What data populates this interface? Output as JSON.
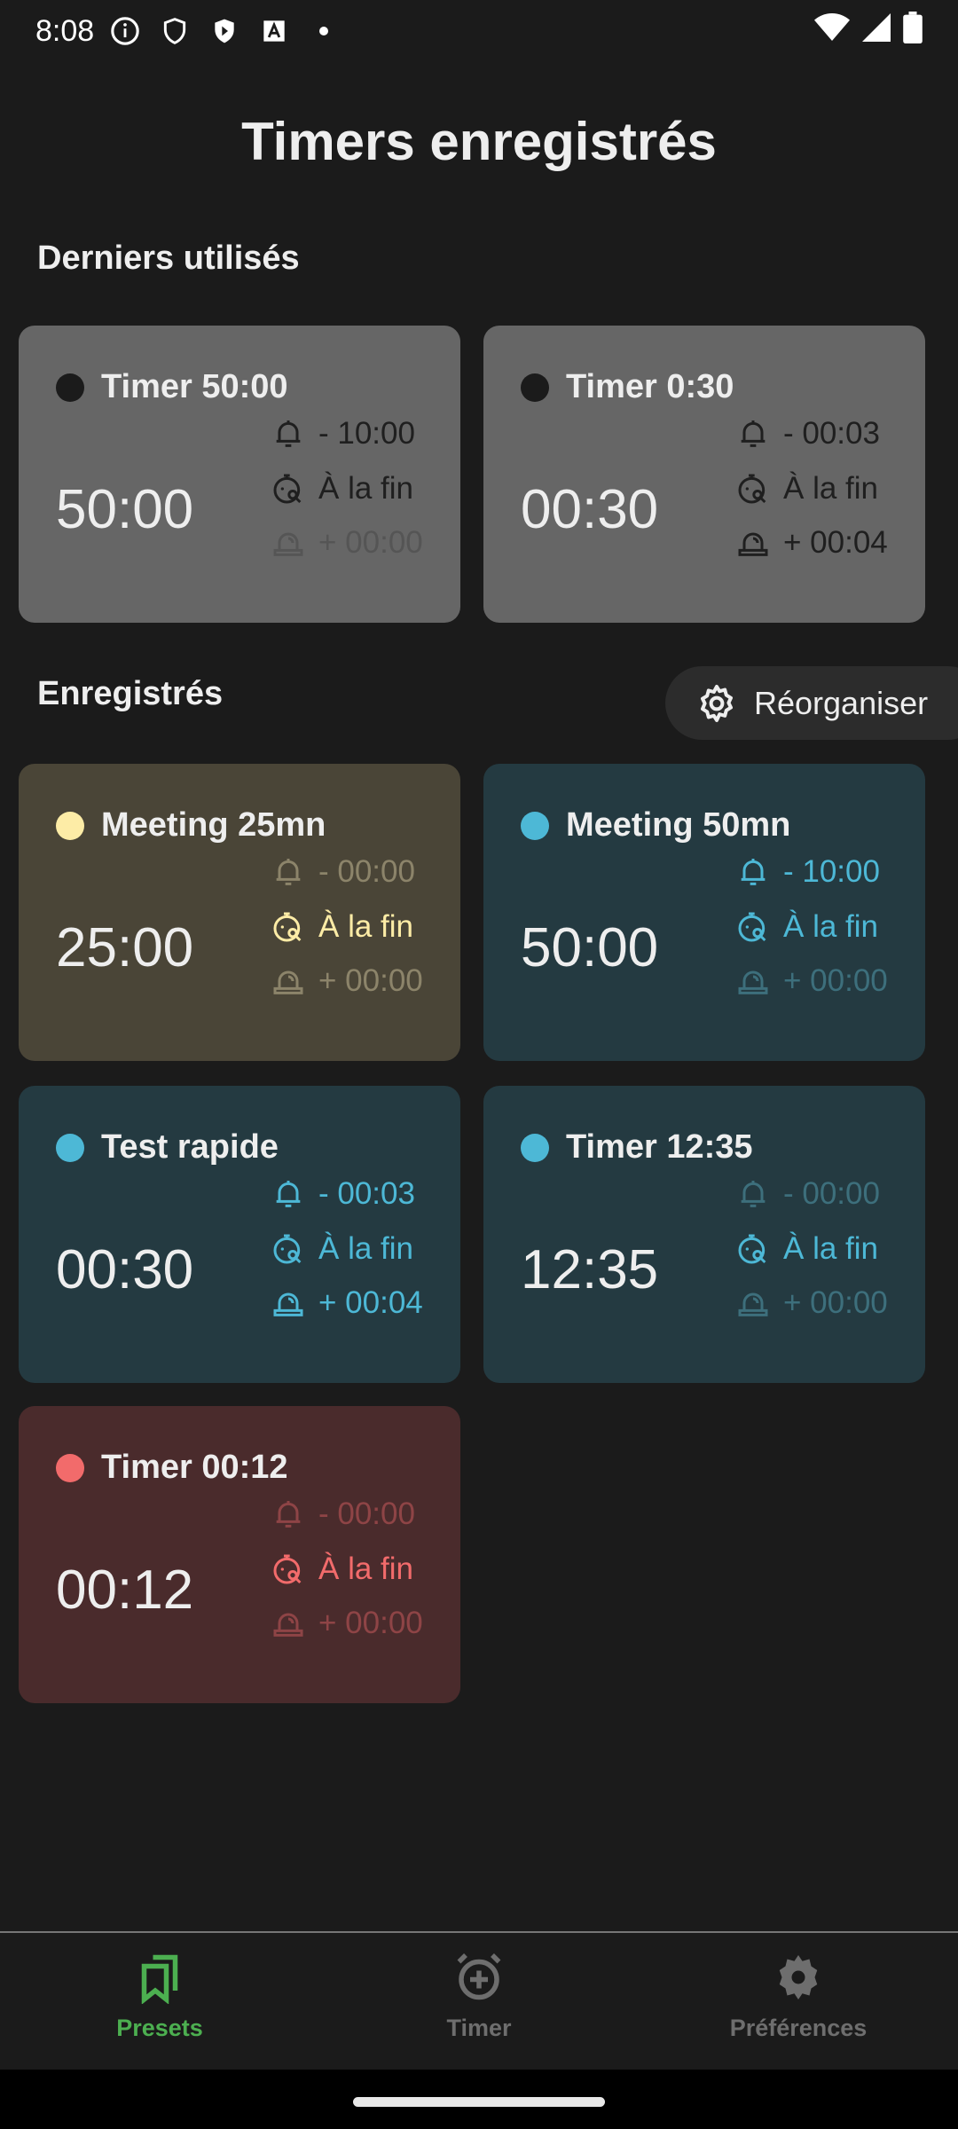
{
  "status_bar": {
    "time": "8:08"
  },
  "title": "Timers enregistrés",
  "recent_section": "Derniers utilisés",
  "saved_section": "Enregistrés",
  "reorganize_button": "Réorganiser",
  "colors": {
    "gray": "#666666",
    "yellow": "#fdeca6",
    "teal": "#4db8d6",
    "red": "#f26b6b",
    "accent_green": "#4caf50"
  },
  "recent": [
    {
      "name": "Timer 50:00",
      "duration": "50:00",
      "prealert": "- 10:00",
      "end": "À la fin",
      "overtime": "+ 00:00",
      "theme": "gray",
      "active": [
        true,
        true,
        false
      ]
    },
    {
      "name": "Timer 0:30",
      "duration": "00:30",
      "prealert": "- 00:03",
      "end": "À la fin",
      "overtime": "+ 00:04",
      "theme": "gray",
      "active": [
        true,
        true,
        true
      ]
    }
  ],
  "saved": [
    {
      "name": "Meeting 25mn",
      "duration": "25:00",
      "prealert": "- 00:00",
      "end": "À la fin",
      "overtime": "+ 00:00",
      "theme": "yellow",
      "active": [
        false,
        true,
        false
      ]
    },
    {
      "name": "Meeting 50mn",
      "duration": "50:00",
      "prealert": "- 10:00",
      "end": "À la fin",
      "overtime": "+ 00:00",
      "theme": "teal",
      "active": [
        true,
        true,
        false
      ]
    },
    {
      "name": "Test rapide",
      "duration": "00:30",
      "prealert": "- 00:03",
      "end": "À la fin",
      "overtime": "+ 00:04",
      "theme": "teal",
      "active": [
        true,
        true,
        true
      ]
    },
    {
      "name": "Timer 12:35",
      "duration": "12:35",
      "prealert": "- 00:00",
      "end": "À la fin",
      "overtime": "+ 00:00",
      "theme": "teal",
      "active": [
        false,
        true,
        false
      ]
    },
    {
      "name": "Timer 00:12",
      "duration": "00:12",
      "prealert": "- 00:00",
      "end": "À la fin",
      "overtime": "+ 00:00",
      "theme": "red",
      "active": [
        false,
        true,
        false
      ]
    }
  ],
  "nav": {
    "presets": "Presets",
    "timer": "Timer",
    "preferences": "Préférences"
  }
}
